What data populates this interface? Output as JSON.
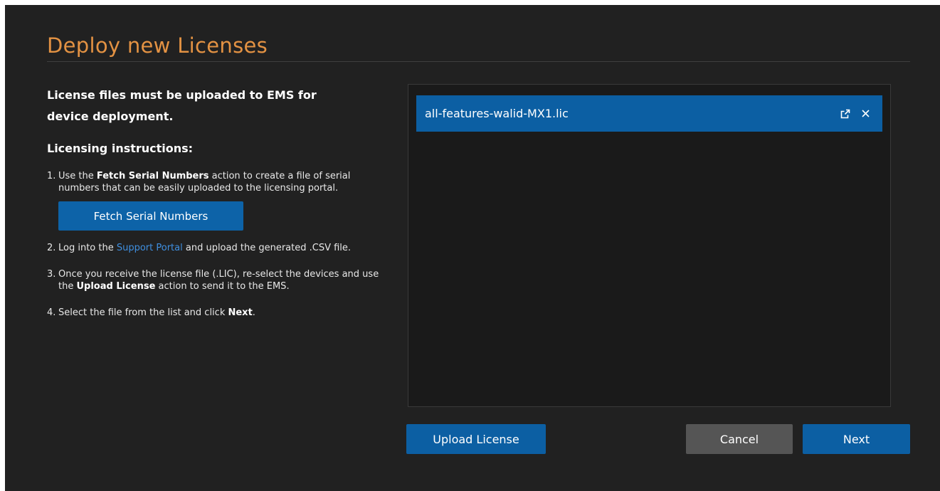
{
  "dialog": {
    "title": "Deploy new Licenses"
  },
  "instructions": {
    "intro": "License files must be uploaded to EMS for device deployment.",
    "heading": "Licensing instructions:",
    "step1": {
      "num": "1.",
      "before": "Use the ",
      "bold": "Fetch Serial Numbers",
      "after": " action to create a file of serial numbers that can be easily uploaded to the licensing portal.",
      "button_label": "Fetch Serial Numbers"
    },
    "step2": {
      "num": "2.",
      "before": "Log into the ",
      "link": "Support Portal",
      "after": " and upload the generated .CSV file."
    },
    "step3": {
      "num": "3.",
      "before": "Once you receive the license file (.LIC), re-select the devices and use the ",
      "bold": "Upload License",
      "after": " action to send it to the EMS."
    },
    "step4": {
      "num": "4.",
      "before": "Select the file from the list and click ",
      "bold": "Next",
      "after": "."
    }
  },
  "file_list": {
    "items": [
      {
        "name": "all-features-walid-MX1.lic",
        "selected": true,
        "icons": [
          "open-external-icon",
          "close-icon"
        ]
      }
    ]
  },
  "actions": {
    "upload_label": "Upload License",
    "cancel_label": "Cancel",
    "next_label": "Next"
  },
  "colors": {
    "background": "#212121",
    "title": "#e39243",
    "accent": "#0c5fa3",
    "cancel": "#555555",
    "link": "#3f8fe0"
  }
}
